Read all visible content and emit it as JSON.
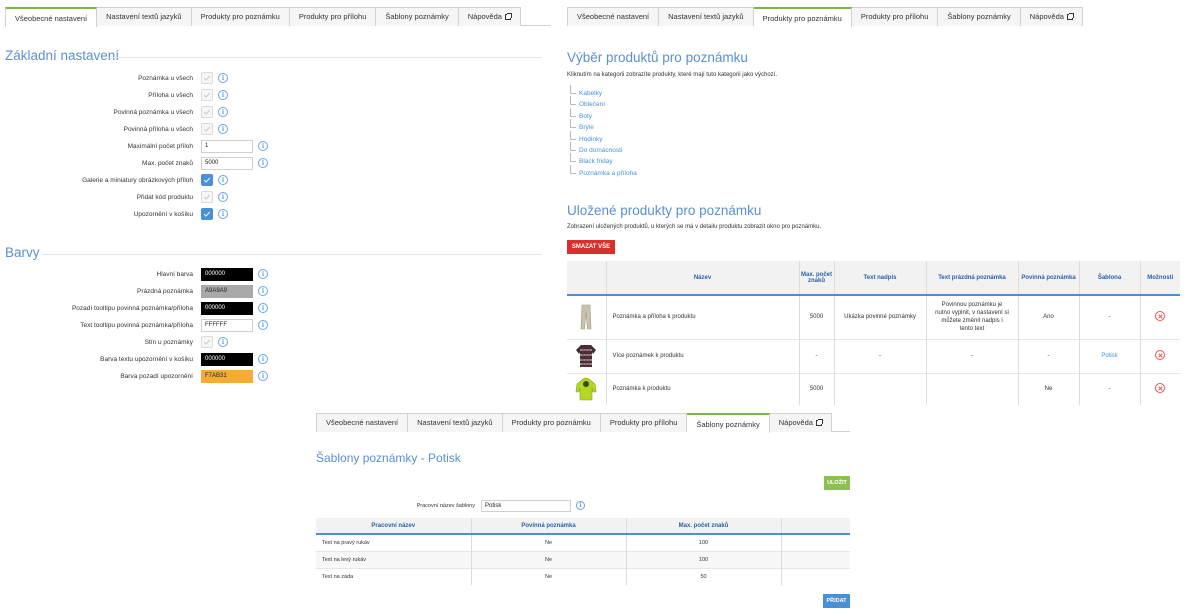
{
  "left_tabs": [
    {
      "label": "Všeobecné nastavení"
    },
    {
      "label": "Nastavení textů jazyků"
    },
    {
      "label": "Produkty pro poznámku"
    },
    {
      "label": "Produkty pro přílohu"
    },
    {
      "label": "Šablony poznámky"
    },
    {
      "label": "Nápověda"
    }
  ],
  "right_tabs": [
    {
      "label": "Všeobecné nastavení"
    },
    {
      "label": "Nastavení textů jazyků"
    },
    {
      "label": "Produkty pro poznámku"
    },
    {
      "label": "Produkty pro přílohu"
    },
    {
      "label": "Šablony poznámky"
    },
    {
      "label": "Nápověda"
    }
  ],
  "bottom_tabs": [
    {
      "label": "Všeobecné nastavení"
    },
    {
      "label": "Nastavení textů jazyků"
    },
    {
      "label": "Produkty pro poznámku"
    },
    {
      "label": "Produkty pro přílohu"
    },
    {
      "label": "Šablony poznámky"
    },
    {
      "label": "Nápověda"
    }
  ],
  "basic": {
    "title": "Základní nastavení",
    "rows": [
      {
        "label": "Poznámka u všech",
        "type": "checkbox",
        "checked": false
      },
      {
        "label": "Příloha u všech",
        "type": "checkbox",
        "checked": false
      },
      {
        "label": "Povinná poznámka u všech",
        "type": "checkbox",
        "checked": false
      },
      {
        "label": "Povinná příloha u všech",
        "type": "checkbox",
        "checked": false
      },
      {
        "label": "Maximální počet příloh",
        "type": "input",
        "value": "1"
      },
      {
        "label": "Max. počet znaků",
        "type": "input",
        "value": "5000"
      },
      {
        "label": "Galerie a miniatury obrázkových příloh",
        "type": "checkbox",
        "checked": true
      },
      {
        "label": "Přidat kód produktu",
        "type": "checkbox",
        "checked": false
      },
      {
        "label": "Upozornění v košíku",
        "type": "checkbox",
        "checked": true
      }
    ]
  },
  "colors": {
    "title": "Barvy",
    "rows": [
      {
        "label": "Hlavní barva",
        "type": "color",
        "value": "000000",
        "bg": "#000000",
        "fg": "#ffffff"
      },
      {
        "label": "Prázdná poznámka",
        "type": "color",
        "value": "A9A9A9",
        "bg": "#a9a9a9",
        "fg": "#222222"
      },
      {
        "label": "Pozadí tooltipu povinná poznámka/příloha",
        "type": "color",
        "value": "000000",
        "bg": "#000000",
        "fg": "#ffffff"
      },
      {
        "label": "Text tooltipu povinná poznámka/příloha",
        "type": "color",
        "value": "FFFFFF",
        "bg": "#ffffff",
        "fg": "#222222"
      },
      {
        "label": "Stín u poznámky",
        "type": "checkbox",
        "checked": false
      },
      {
        "label": "Barva textu upozornění v košíku",
        "type": "color",
        "value": "000000",
        "bg": "#000000",
        "fg": "#ffffff"
      },
      {
        "label": "Barva pozadí upozornění",
        "type": "color",
        "value": "F7AB31",
        "bg": "#f7ab31",
        "fg": "#222222"
      }
    ]
  },
  "product_select": {
    "title": "Výběr produktů pro poznámku",
    "desc": "Kliknutím na kategorii zobrazíte produkty, které mají tuto kategorii jako výchozí.",
    "categories": [
      "Kabelky",
      "Oblečení",
      "Boty",
      "Brýle",
      "Hodinky",
      "Do domácnosti",
      "Black friday",
      "Poznámka a příloha"
    ]
  },
  "saved": {
    "title": "Uložené produkty pro poznámku",
    "desc": "Zobrazení uložených produktů, u kterých se má v detailu produktu zobrazit okno pro poznámku.",
    "delete_all": "SMAZAT VŠE",
    "columns": [
      "",
      "Název",
      "Max. počet znaků",
      "Text nadpis",
      "Text prázdná poznámka",
      "Povinná poznámka",
      "Šablona",
      "Možnosti"
    ],
    "rows": [
      {
        "name": "Poznámka a příloha k produktu",
        "max": "5000",
        "heading": "Ukázka povinné poznámky",
        "empty": "Povinnou poznámku je nutno vyplnit, v nastavení si můžete změnit nadpis i tento text",
        "required": "Ano",
        "template": "-",
        "thumb": "pants-thumbnail"
      },
      {
        "name": "Více poznámek k produktu",
        "max": "-",
        "heading": "-",
        "empty": "-",
        "required": "-",
        "template": "Potisk",
        "thumb": "shirt-thumbnail"
      },
      {
        "name": "Poznámka k produktu",
        "max": "5000",
        "heading": "",
        "empty": "",
        "required": "Ne",
        "template": "-",
        "thumb": "hoodie-thumbnail"
      }
    ]
  },
  "templates": {
    "title": "Šablony poznámky - Potisk",
    "save": "ULOŽIT",
    "name_label": "Pracovní název šablony",
    "name_value": "Potisk",
    "columns": [
      "Pracovní název",
      "Povinná poznámka",
      "Max. počet znaků",
      ""
    ],
    "rows": [
      {
        "name": "Text na pravý rukáv",
        "required": "Ne",
        "max": "100"
      },
      {
        "name": "Text na levý rukáv",
        "required": "Ne",
        "max": "100"
      },
      {
        "name": "Text na záda",
        "required": "Ne",
        "max": "50"
      }
    ],
    "add": "PŘIDAT"
  },
  "colors_accent": {
    "blue": "#4a90d9",
    "green_button": "#8cc152",
    "red_button": "#d9302e",
    "tab_active": "#7ab648"
  }
}
